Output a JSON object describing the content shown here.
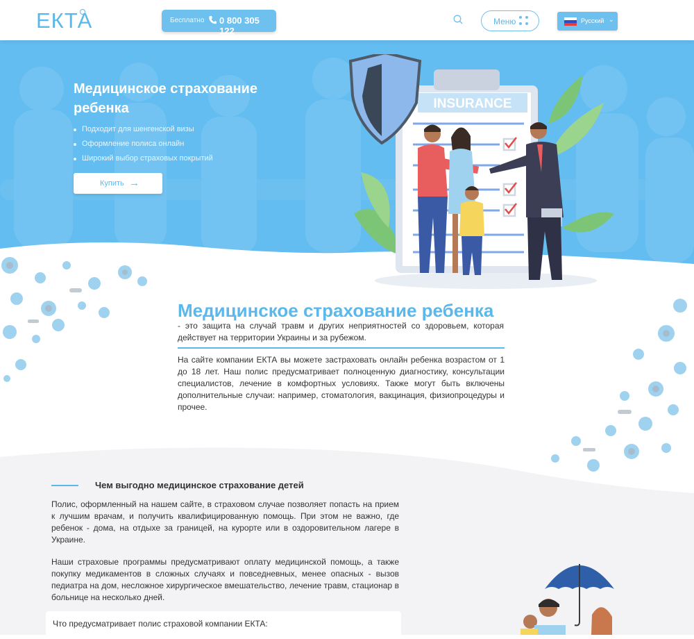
{
  "header": {
    "logo": "ЕКТА",
    "phone_free": "Бесплатно",
    "phone_number": "0 800 305 122",
    "menu_label": "Меню",
    "language": "Русский"
  },
  "hero": {
    "title": "Медицинское страхование ребенка",
    "bullets": [
      "Подходит для шенгенской визы",
      "Оформление полиса онлайн",
      "Широкий выбор страховых покрытий"
    ],
    "buy_label": "Купить",
    "insurance_sign": "INSURANCE"
  },
  "article": {
    "title": "Медицинское страхование ребенка",
    "subtitle": " - это защита на случай травм и других неприятностей со здоровьем, которая действует на территории Украины и за рубежом.",
    "body": "На сайте компании ЕКТА вы можете застраховать онлайн ребенка возрастом от 1 до 18 лет. Наш полис предусматривает полноценную диагностику, консультации специалистов, лечение в комфортных условиях. Также могут быть включены дополнительные случаи: например, стоматология, вакцинация, физиопроцедуры и прочее."
  },
  "benefits": {
    "title": "Чем выгодно медицинское страхование детей",
    "p1": "Полис, оформленный на нашем сайте, в страховом случае позволяет попасть на прием к лучшим врачам, и получить квалифицированную помощь. При этом не важно, где ребенок - дома, на отдыхе за границей, на курорте или в оздоровительном лагере в Украине.",
    "p2": "Наши страховые программы предусматривают оплату медицинской помощь, а также покупку медикаментов в сложных случаях и повседневных, менее опасных - вызов педиатра на дом, несложное хирургическое вмешательство, лечение травм, стационар в больнице на несколько дней.",
    "card_label": "Что предусматривает полис страховой компании ЕКТА:"
  },
  "colors": {
    "accent": "#5bb8ea",
    "hero_bg": "#64bdf0",
    "section_bg": "#f3f3f5"
  }
}
